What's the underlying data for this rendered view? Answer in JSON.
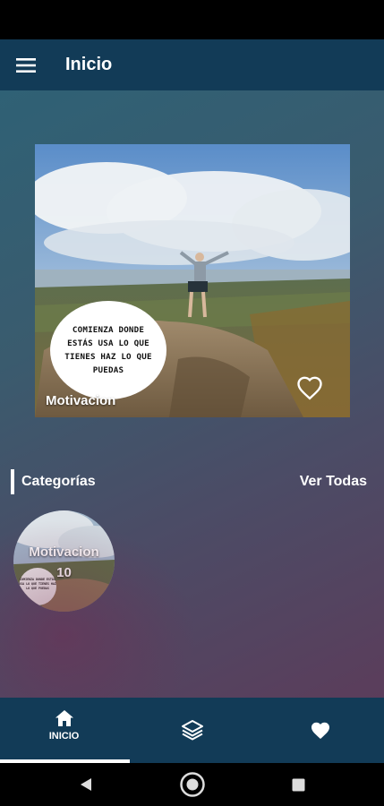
{
  "app_bar": {
    "title": "Inicio",
    "menu_icon": "hamburger-menu-icon"
  },
  "featured": {
    "quote": "COMIENZA DONDE ESTÁS USA LO QUE TIENES HAZ LO QUE PUEDAS",
    "label": "Motivacion",
    "favorite_icon": "heart-outline-icon"
  },
  "categories_section": {
    "title": "Categorías",
    "see_all": "Ver Todas",
    "items": [
      {
        "name": "Motivacion",
        "count": "10",
        "mini_quote": "COMIENZA DONDE ESTÁS USA LO QUE TIENES HAZ LO QUE PUEDAS"
      }
    ]
  },
  "bottom_nav": {
    "items": [
      {
        "label": "INICIO",
        "icon": "home-icon",
        "active": true
      },
      {
        "label": "",
        "icon": "layers-icon",
        "active": false
      },
      {
        "label": "",
        "icon": "heart-icon",
        "active": false
      }
    ]
  },
  "colors": {
    "app_bar": "#123b57",
    "bottom_nav": "#123b57",
    "text": "#ffffff"
  }
}
